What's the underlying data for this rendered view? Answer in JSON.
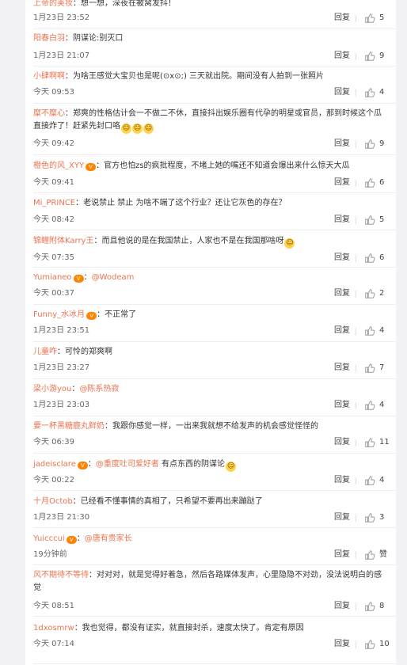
{
  "reply_label": "回复",
  "comments": [
    {
      "user": "上帝的美妆",
      "text": "：想一想，深夜在被窝发抖！",
      "time": "1月23日 23:52",
      "likes": "5"
    },
    {
      "user": "阳春白羽",
      "text": "：阴谋论:别灭口",
      "time": "1月23日 21:07",
      "likes": "9"
    },
    {
      "user": "小肆啊啊",
      "text": "：为啥王感觉大宝贝也是呢(⊙x⊙;) 三天就出院。期间没有人拍到一张照片",
      "time": "今天 09:53",
      "likes": "4"
    },
    {
      "user": "糜不糜心",
      "text": "：郑爽的性格估计会一不做二不休，直接抖出娱乐圈有代孕的明星或官员，那到时候这个瓜直接炸了！赶紧先封口咯",
      "time": "今天 09:42",
      "likes": "9"
    },
    {
      "user": "橙色的风_XYY",
      "text": "：官方也怕zs的疯批程度，不堵上她的嘴还不知道会爆出来什么惊天大瓜",
      "time": "今天 09:41",
      "likes": "6"
    },
    {
      "user": "Mi_PRINCE",
      "text": "：老说禁止 禁止 为啥不端了这个行业？还让它灰色的存在？",
      "time": "今天 08:42",
      "likes": "5"
    },
    {
      "user": "锦鲤附体Karry王",
      "text": "：而且他说的是在我国禁止，人家也不是在我国那啥呀",
      "time": "今天 07:35",
      "likes": "6"
    },
    {
      "user": "Yumianeo",
      "text": "：",
      "mention": "@Wodeam",
      "time": "今天 00:37",
      "likes": "2"
    },
    {
      "user": "Funny_水冰月",
      "text": "：不正常了",
      "time": "1月23日 23:51",
      "likes": "4"
    },
    {
      "user": "儿童咋",
      "text": "：可怜的郑爽啊",
      "time": "1月23日 23:27",
      "likes": "7"
    },
    {
      "user": "梁小游you",
      "text": "：",
      "mention": "@陈系热寂",
      "time": "1月23日 23:03",
      "likes": "4"
    },
    {
      "user": "要一杯黑糖鹿丸鲜奶",
      "text": "：我跟你感觉一样，一出来我就想不给发声的机会感觉怪怪的",
      "time": "今天 06:39",
      "likes": "11"
    },
    {
      "user": "jadeisclare",
      "text": "：",
      "mention": "@重度吐司爱好者",
      "text2": " 有点东西的阴谋论",
      "time": "今天 00:22",
      "likes": "4"
    },
    {
      "user": "十月Octob",
      "text": "：已经看不懂事情的真相了，只希望不要再出来蹦跶了",
      "time": "1月23日 21:30",
      "likes": "3"
    },
    {
      "user": "Yuicccui",
      "text": "：",
      "mention": "@唐有贵家长",
      "time": "19分钟前",
      "likes": "赞"
    },
    {
      "user": "风不期待不等待",
      "text": "：对对对，就是觉得好着急，然后各路媒体发声，心里隐隐不对劲，没法说明白的感觉",
      "time": "今天 08:51",
      "likes": "8"
    },
    {
      "user": "1dxosmrw",
      "text": "：我也觉得，都没有证实，就直接封杀，速度太快了。肯定有原因",
      "time": "今天 07:14",
      "likes": "10"
    }
  ]
}
